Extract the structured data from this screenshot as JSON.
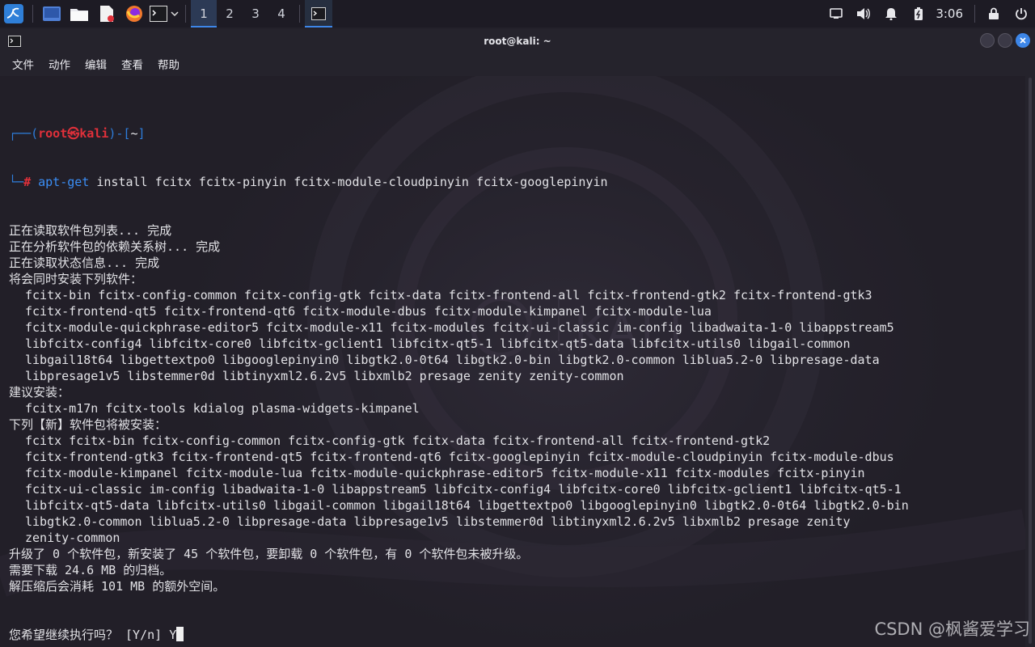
{
  "panel": {
    "workspaces": [
      "1",
      "2",
      "3",
      "4"
    ],
    "active_workspace": "1",
    "clock": "3:06",
    "launchers": [
      "kali-menu-icon",
      "desktop-icon",
      "file-manager-icon",
      "text-editor-icon",
      "firefox-icon",
      "terminal-icon"
    ],
    "tray": [
      "display-icon",
      "volume-icon",
      "notification-bell-icon",
      "battery-icon",
      "lock-icon",
      "power-icon"
    ]
  },
  "window": {
    "title": "root@kali: ~",
    "menu": [
      "文件",
      "动作",
      "编辑",
      "查看",
      "帮助"
    ]
  },
  "terminal": {
    "prompt": {
      "top_left": "┌──(",
      "user_host": "root㉿kali",
      "top_mid": ")-[",
      "cwd": "~",
      "top_right": "]",
      "bottom_left": "└─",
      "hash": "#",
      "cmd_name": "apt-get",
      "cmd_args": " install fcitx fcitx-pinyin fcitx-module-cloudpinyin fcitx-googlepinyin"
    },
    "lines": [
      {
        "text": "正在读取软件包列表... 完成",
        "indent": false
      },
      {
        "text": "正在分析软件包的依赖关系树... 完成",
        "indent": false
      },
      {
        "text": "正在读取状态信息... 完成",
        "indent": false
      },
      {
        "text": "将会同时安装下列软件：",
        "indent": false
      },
      {
        "text": "fcitx-bin fcitx-config-common fcitx-config-gtk fcitx-data fcitx-frontend-all fcitx-frontend-gtk2 fcitx-frontend-gtk3",
        "indent": true
      },
      {
        "text": "fcitx-frontend-qt5 fcitx-frontend-qt6 fcitx-module-dbus fcitx-module-kimpanel fcitx-module-lua",
        "indent": true
      },
      {
        "text": "fcitx-module-quickphrase-editor5 fcitx-module-x11 fcitx-modules fcitx-ui-classic im-config libadwaita-1-0 libappstream5",
        "indent": true
      },
      {
        "text": "libfcitx-config4 libfcitx-core0 libfcitx-gclient1 libfcitx-qt5-1 libfcitx-qt5-data libfcitx-utils0 libgail-common",
        "indent": true
      },
      {
        "text": "libgail18t64 libgettextpo0 libgooglepinyin0 libgtk2.0-0t64 libgtk2.0-bin libgtk2.0-common liblua5.2-0 libpresage-data",
        "indent": true
      },
      {
        "text": "libpresage1v5 libstemmer0d libtinyxml2.6.2v5 libxmlb2 presage zenity zenity-common",
        "indent": true
      },
      {
        "text": "建议安装：",
        "indent": false
      },
      {
        "text": "fcitx-m17n fcitx-tools kdialog plasma-widgets-kimpanel",
        "indent": true
      },
      {
        "text": "下列【新】软件包将被安装：",
        "indent": false
      },
      {
        "text": "fcitx fcitx-bin fcitx-config-common fcitx-config-gtk fcitx-data fcitx-frontend-all fcitx-frontend-gtk2",
        "indent": true
      },
      {
        "text": "fcitx-frontend-gtk3 fcitx-frontend-qt5 fcitx-frontend-qt6 fcitx-googlepinyin fcitx-module-cloudpinyin fcitx-module-dbus",
        "indent": true
      },
      {
        "text": "fcitx-module-kimpanel fcitx-module-lua fcitx-module-quickphrase-editor5 fcitx-module-x11 fcitx-modules fcitx-pinyin",
        "indent": true
      },
      {
        "text": "fcitx-ui-classic im-config libadwaita-1-0 libappstream5 libfcitx-config4 libfcitx-core0 libfcitx-gclient1 libfcitx-qt5-1",
        "indent": true
      },
      {
        "text": "libfcitx-qt5-data libfcitx-utils0 libgail-common libgail18t64 libgettextpo0 libgooglepinyin0 libgtk2.0-0t64 libgtk2.0-bin",
        "indent": true
      },
      {
        "text": "libgtk2.0-common liblua5.2-0 libpresage-data libpresage1v5 libstemmer0d libtinyxml2.6.2v5 libxmlb2 presage zenity",
        "indent": true
      },
      {
        "text": "zenity-common",
        "indent": true
      },
      {
        "text": "升级了 0 个软件包，新安装了 45 个软件包，要卸载 0 个软件包，有 0 个软件包未被升级。",
        "indent": false
      },
      {
        "text": "需要下载 24.6 MB 的归档。",
        "indent": false
      },
      {
        "text": "解压缩后会消耗 101 MB 的额外空间。",
        "indent": false
      }
    ],
    "question": "您希望继续执行吗？ [Y/n] ",
    "answer": "Y"
  },
  "watermark": "CSDN @枫酱爱学习",
  "colors": {
    "accent": "#3d86e8",
    "prompt_blue": "#2e7ddb",
    "prompt_red": "#e0303a"
  }
}
